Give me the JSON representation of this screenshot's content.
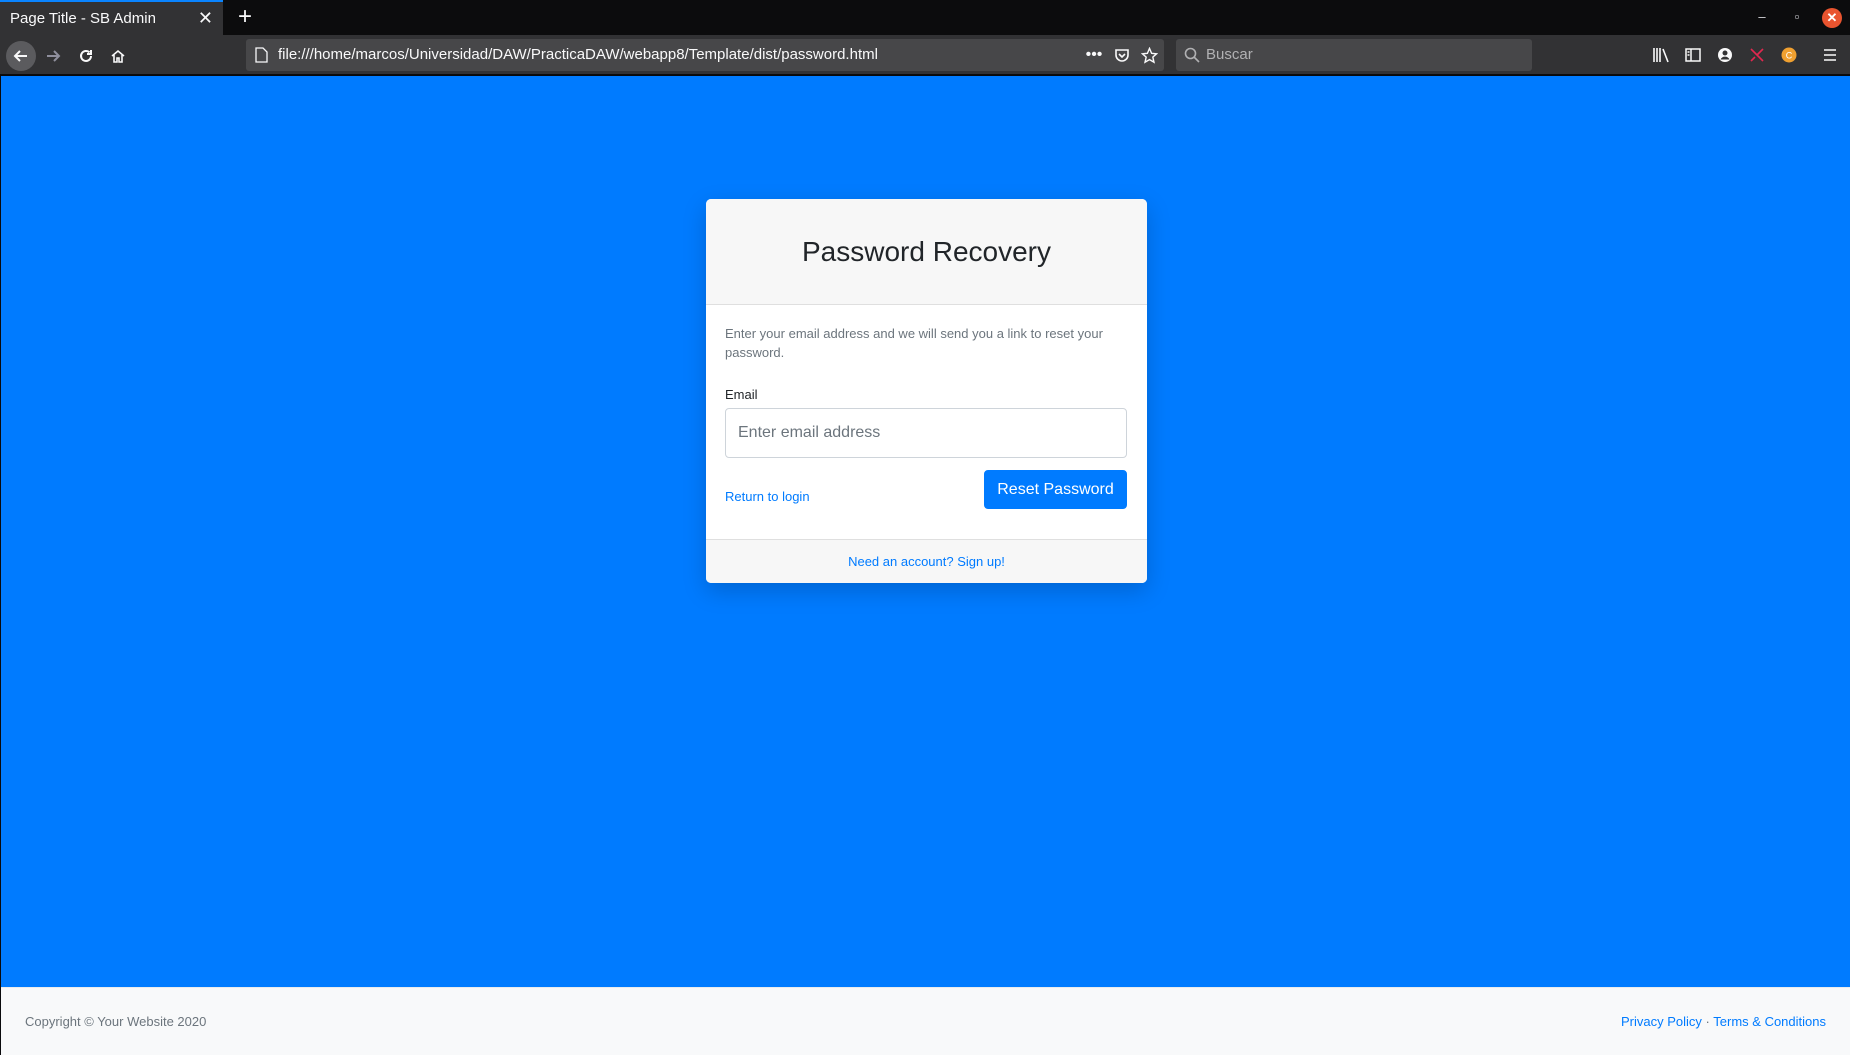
{
  "browser": {
    "tab_title": "Page Title - SB Admin",
    "url": "file:///home/marcos/Universidad/DAW/PracticaDAW/webapp8/Template/dist/password.html",
    "search_placeholder": "Buscar",
    "accent_color": "#0a84ff"
  },
  "card": {
    "title": "Password Recovery",
    "help_text": "Enter your email address and we will send you a link to reset your password.",
    "email_label": "Email",
    "email_placeholder": "Enter email address",
    "email_value": "",
    "return_link": "Return to login",
    "submit_label": "Reset Password",
    "signup_link": "Need an account? Sign up!"
  },
  "footer": {
    "copyright": "Copyright © Your Website 2020",
    "privacy": "Privacy Policy",
    "separator": "·",
    "terms": "Terms & Conditions"
  },
  "colors": {
    "page_background": "#007bff",
    "primary": "#007bff"
  }
}
